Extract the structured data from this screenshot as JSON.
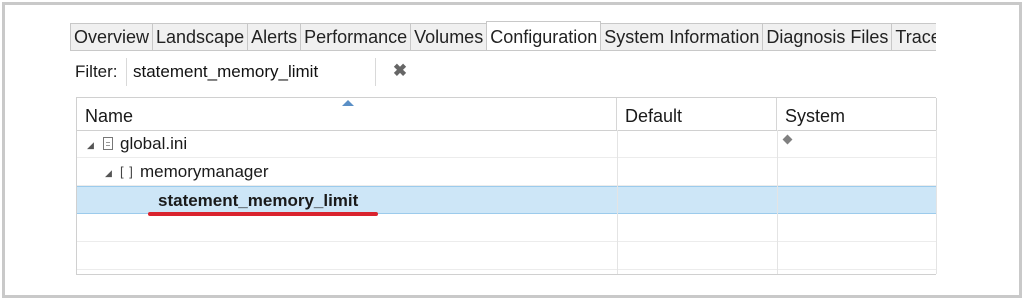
{
  "tabs": [
    {
      "label": "Overview",
      "active": false
    },
    {
      "label": "Landscape",
      "active": false
    },
    {
      "label": "Alerts",
      "active": false
    },
    {
      "label": "Performance",
      "active": false
    },
    {
      "label": "Volumes",
      "active": false
    },
    {
      "label": "Configuration",
      "active": true
    },
    {
      "label": "System Information",
      "active": false
    },
    {
      "label": "Diagnosis Files",
      "active": false
    },
    {
      "label": "Trace C",
      "active": false
    }
  ],
  "filter": {
    "label": "Filter:",
    "value": "statement_memory_limit",
    "clear_icon": "clear-x-icon"
  },
  "table": {
    "columns": [
      "Name",
      "Default",
      "System"
    ],
    "rows": [
      {
        "name": "global.ini",
        "icon": "file-icon",
        "expanded": true,
        "system_marker": "diamond"
      },
      {
        "name": "memorymanager",
        "icon": "section-icon",
        "expanded": true
      },
      {
        "name": "statement_memory_limit",
        "selected": true,
        "highlighted": true
      }
    ]
  },
  "colors": {
    "selection": "#cde6f7",
    "highlight_underline": "#d9232e",
    "sort_arrow": "#5a8fc6"
  }
}
